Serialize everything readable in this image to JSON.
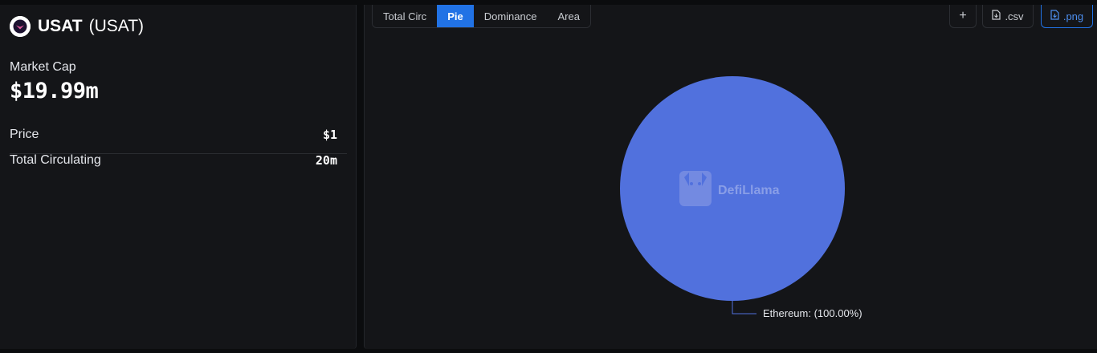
{
  "coin": {
    "name": "USAT",
    "symbol": "(USAT)",
    "logo_icon": "usat-logo-icon"
  },
  "market_cap": {
    "label": "Market Cap",
    "value": "$19.99m"
  },
  "stats": [
    {
      "label": "Price",
      "value": "$1"
    },
    {
      "label": "Total Circulating",
      "value": "20m"
    }
  ],
  "tabs": [
    {
      "label": "Total Circ",
      "active": false
    },
    {
      "label": "Pie",
      "active": true
    },
    {
      "label": "Dominance",
      "active": false
    },
    {
      "label": "Area",
      "active": false
    }
  ],
  "toolbar": {
    "add_label": "+",
    "csv_label": ".csv",
    "png_label": ".png",
    "file_icon": "file-icon"
  },
  "watermark": "DefiLlama",
  "colors": {
    "accent": "#2172e5",
    "slice": "#5171dd",
    "panel": "#141518"
  },
  "chart_data": {
    "type": "pie",
    "categories": [
      "Ethereum"
    ],
    "values": [
      100.0
    ],
    "labels": [
      "Ethereum: (100.00%)"
    ]
  }
}
